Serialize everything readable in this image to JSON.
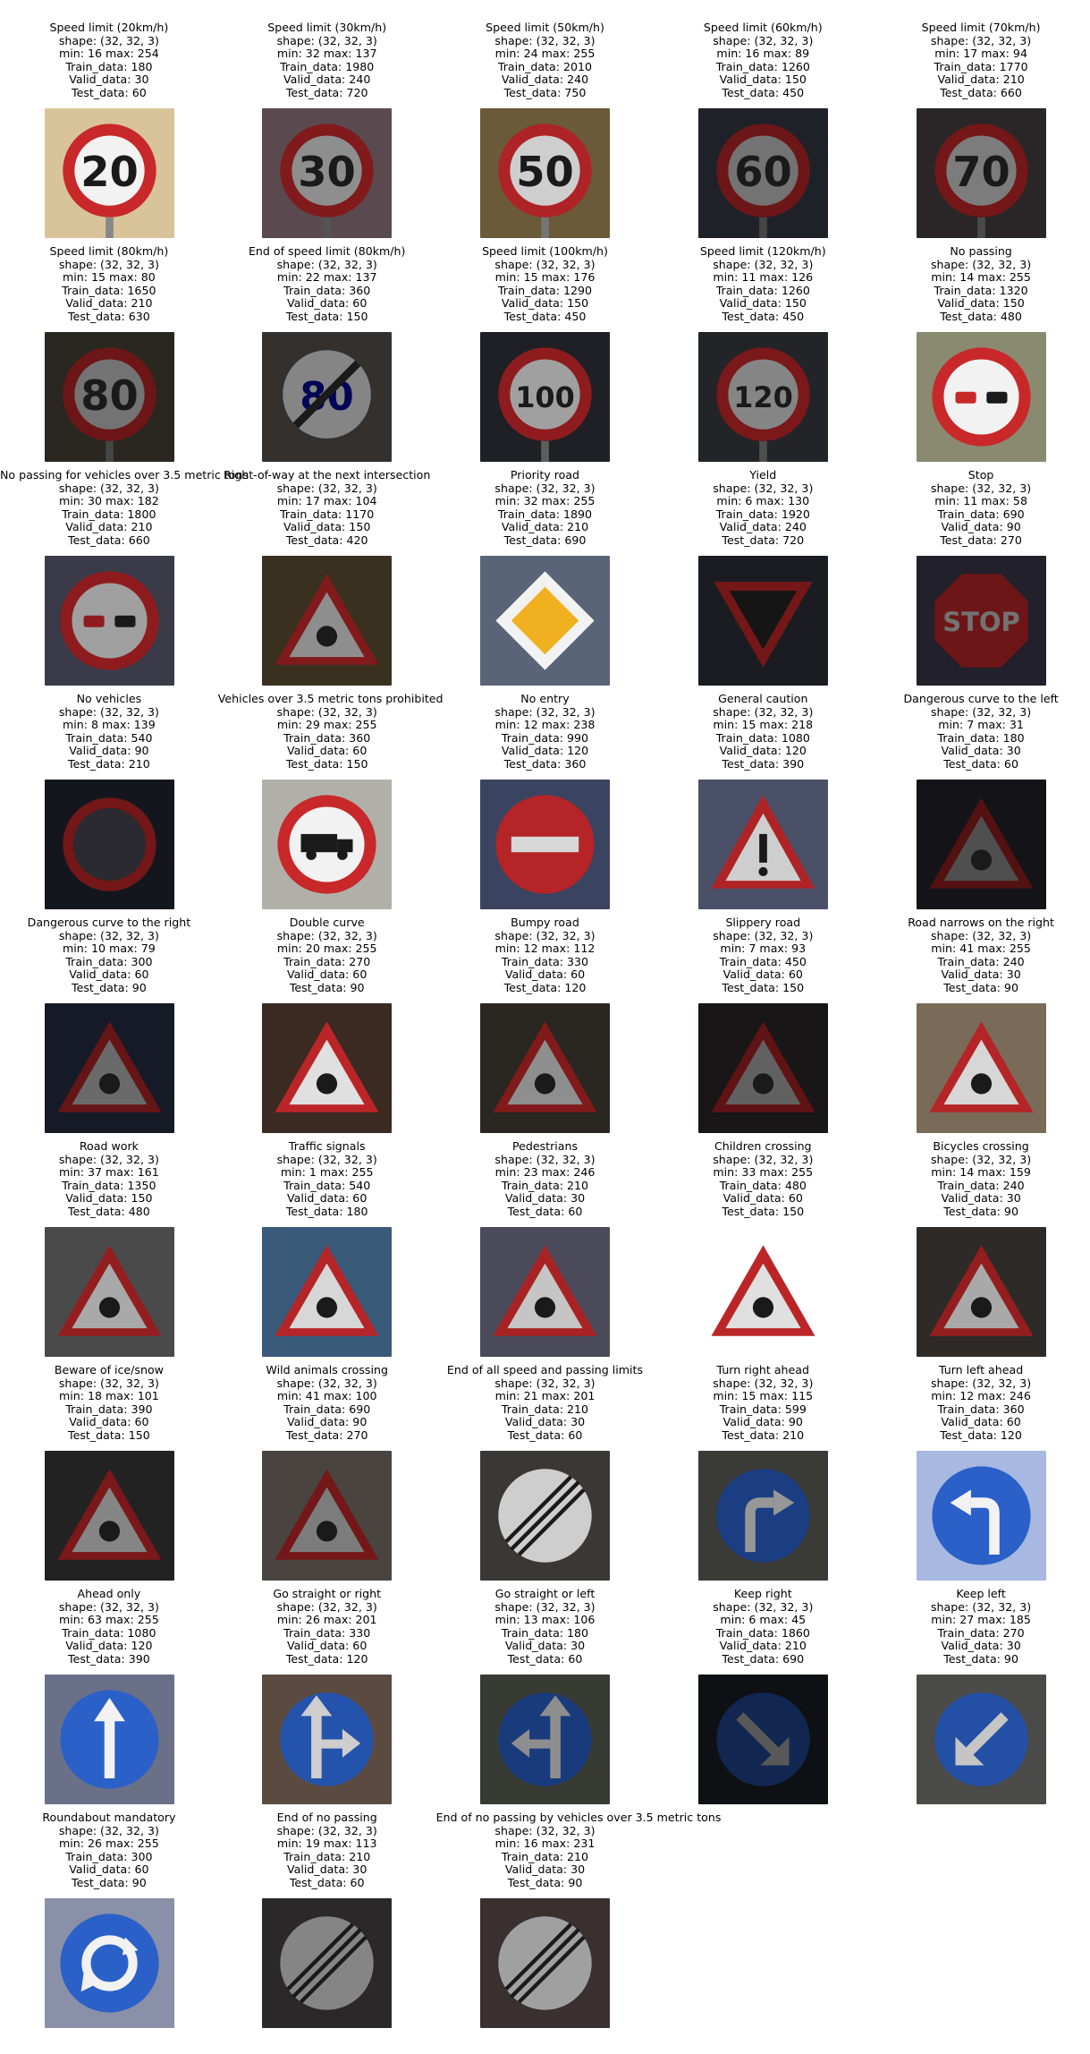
{
  "samples": [
    {
      "title": "Speed limit (20km/h)",
      "shape": "shape: (32, 32, 3)",
      "minmax": "min: 16 max: 254",
      "train": "Train_data: 180",
      "valid": "Valid_data: 30",
      "test": "Test_data: 60",
      "sign": "circle-number",
      "text": "20",
      "bg": "#d9c49a",
      "bright": 1.0
    },
    {
      "title": "Speed limit (30km/h)",
      "shape": "shape: (32, 32, 3)",
      "minmax": "min: 32 max: 137",
      "train": "Train_data: 1980",
      "valid": "Valid_data: 240",
      "test": "Test_data: 720",
      "sign": "circle-number",
      "text": "30",
      "bg": "#5a4a50",
      "bright": 0.45
    },
    {
      "title": "Speed limit (50km/h)",
      "shape": "shape: (32, 32, 3)",
      "minmax": "min: 24 max: 255",
      "train": "Train_data: 2010",
      "valid": "Valid_data: 240",
      "test": "Test_data: 750",
      "sign": "circle-number",
      "text": "50",
      "bg": "#6a5a3a",
      "bright": 0.8
    },
    {
      "title": "Speed limit (60km/h)",
      "shape": "shape: (32, 32, 3)",
      "minmax": "min: 16 max: 89",
      "train": "Train_data: 1260",
      "valid": "Valid_data: 150",
      "test": "Test_data: 450",
      "sign": "circle-number",
      "text": "60",
      "bg": "#1e2228",
      "bright": 0.3
    },
    {
      "title": "Speed limit (70km/h)",
      "shape": "shape: (32, 32, 3)",
      "minmax": "min: 17 max: 94",
      "train": "Train_data: 1770",
      "valid": "Valid_data: 210",
      "test": "Test_data: 660",
      "sign": "circle-number",
      "text": "70",
      "bg": "#2a2628",
      "bright": 0.35
    },
    {
      "title": "Speed limit (80km/h)",
      "shape": "shape: (32, 32, 3)",
      "minmax": "min: 15 max: 80",
      "train": "Train_data: 1650",
      "valid": "Valid_data: 210",
      "test": "Test_data: 630",
      "sign": "circle-number",
      "text": "80",
      "bg": "#2a2620",
      "bright": 0.3
    },
    {
      "title": "End of speed limit (80km/h)",
      "shape": "shape: (32, 32, 3)",
      "minmax": "min: 22 max: 137",
      "train": "Train_data: 360",
      "valid": "Valid_data: 60",
      "test": "Test_data: 150",
      "sign": "end-number",
      "text": "80",
      "bg": "#33302e",
      "bright": 0.4
    },
    {
      "title": "Speed limit (100km/h)",
      "shape": "shape: (32, 32, 3)",
      "minmax": "min: 15 max: 176",
      "train": "Train_data: 1290",
      "valid": "Valid_data: 150",
      "test": "Test_data: 450",
      "sign": "circle-number",
      "text": "100",
      "bg": "#1e2026",
      "bright": 0.55
    },
    {
      "title": "Speed limit (120km/h)",
      "shape": "shape: (32, 32, 3)",
      "minmax": "min: 11 max: 126",
      "train": "Train_data: 1260",
      "valid": "Valid_data: 150",
      "test": "Test_data: 450",
      "sign": "circle-number",
      "text": "120",
      "bg": "#222428",
      "bright": 0.4
    },
    {
      "title": "No passing",
      "shape": "shape: (32, 32, 3)",
      "minmax": "min: 14 max: 255",
      "train": "Train_data: 1320",
      "valid": "Valid_data: 150",
      "test": "Test_data: 480",
      "sign": "circle-cars",
      "text": "",
      "bg": "#8a8a70",
      "bright": 1.0
    },
    {
      "title": "No passing for vehicles over 3.5 metric tons",
      "shape": "shape: (32, 32, 3)",
      "minmax": "min: 30 max: 182",
      "train": "Train_data: 1800",
      "valid": "Valid_data: 210",
      "test": "Test_data: 660",
      "sign": "circle-cars",
      "text": "",
      "bg": "#3a3a48",
      "bright": 0.55
    },
    {
      "title": "Right-of-way at the next intersection",
      "shape": "shape: (32, 32, 3)",
      "minmax": "min: 17 max: 104",
      "train": "Train_data: 1170",
      "valid": "Valid_data: 150",
      "test": "Test_data: 420",
      "sign": "triangle",
      "text": "",
      "bg": "#3a3020",
      "bright": 0.45
    },
    {
      "title": "Priority road",
      "shape": "shape: (32, 32, 3)",
      "minmax": "min: 32 max: 255",
      "train": "Train_data: 1890",
      "valid": "Valid_data: 210",
      "test": "Test_data: 690",
      "sign": "diamond",
      "text": "",
      "bg": "#5a6478",
      "bright": 1.0
    },
    {
      "title": "Yield",
      "shape": "shape: (32, 32, 3)",
      "minmax": "min: 6 max: 130",
      "train": "Train_data: 1920",
      "valid": "Valid_data: 240",
      "test": "Test_data: 720",
      "sign": "yield",
      "text": "",
      "bg": "#1a1c22",
      "bright": 0.35
    },
    {
      "title": "Stop",
      "shape": "shape: (32, 32, 3)",
      "minmax": "min: 11 max: 58",
      "train": "Train_data: 690",
      "valid": "Valid_data: 90",
      "test": "Test_data: 270",
      "sign": "stop",
      "text": "STOP",
      "bg": "#22202a",
      "bright": 0.3
    },
    {
      "title": "No vehicles",
      "shape": "shape: (32, 32, 3)",
      "minmax": "min: 8 max: 139",
      "train": "Train_data: 540",
      "valid": "Valid_data: 90",
      "test": "Test_data: 210",
      "sign": "circle-empty",
      "text": "",
      "bg": "#14161e",
      "bright": 0.35
    },
    {
      "title": "Vehicles over 3.5 metric tons prohibited",
      "shape": "shape: (32, 32, 3)",
      "minmax": "min: 29 max: 255",
      "train": "Train_data: 360",
      "valid": "Valid_data: 60",
      "test": "Test_data: 150",
      "sign": "circle-truck",
      "text": "",
      "bg": "#b0b0a8",
      "bright": 1.0
    },
    {
      "title": "No entry",
      "shape": "shape: (32, 32, 3)",
      "minmax": "min: 12 max: 238",
      "train": "Train_data: 990",
      "valid": "Valid_data: 120",
      "test": "Test_data: 360",
      "sign": "no-entry",
      "text": "",
      "bg": "#3a4460",
      "bright": 0.85
    },
    {
      "title": "General caution",
      "shape": "shape: (32, 32, 3)",
      "minmax": "min: 15 max: 218",
      "train": "Train_data: 1080",
      "valid": "Valid_data: 120",
      "test": "Test_data: 390",
      "sign": "caution",
      "text": "",
      "bg": "#4a5068",
      "bright": 0.8
    },
    {
      "title": "Dangerous curve to the left",
      "shape": "shape: (32, 32, 3)",
      "minmax": "min: 7 max: 31",
      "train": "Train_data: 180",
      "valid": "Valid_data: 30",
      "test": "Test_data: 60",
      "sign": "triangle",
      "text": "",
      "bg": "#141418",
      "bright": 0.1
    },
    {
      "title": "Dangerous curve to the right",
      "shape": "shape: (32, 32, 3)",
      "minmax": "min: 10 max: 79",
      "train": "Train_data: 300",
      "valid": "Valid_data: 60",
      "test": "Test_data: 90",
      "sign": "triangle",
      "text": "",
      "bg": "#161a26",
      "bright": 0.25
    },
    {
      "title": "Double curve",
      "shape": "shape: (32, 32, 3)",
      "minmax": "min: 20 max: 255",
      "train": "Train_data: 270",
      "valid": "Valid_data: 60",
      "test": "Test_data: 90",
      "sign": "triangle",
      "text": "",
      "bg": "#3a2a22",
      "bright": 0.9
    },
    {
      "title": "Bumpy road",
      "shape": "shape: (32, 32, 3)",
      "minmax": "min: 12 max: 112",
      "train": "Train_data: 330",
      "valid": "Valid_data: 60",
      "test": "Test_data: 120",
      "sign": "triangle",
      "text": "",
      "bg": "#2a2622",
      "bright": 0.45
    },
    {
      "title": "Slippery road",
      "shape": "shape: (32, 32, 3)",
      "minmax": "min: 7 max: 93",
      "train": "Train_data: 450",
      "valid": "Valid_data: 60",
      "test": "Test_data: 150",
      "sign": "triangle",
      "text": "",
      "bg": "#181616",
      "bright": 0.2
    },
    {
      "title": "Road narrows on the right",
      "shape": "shape: (32, 32, 3)",
      "minmax": "min: 41 max: 255",
      "train": "Train_data: 240",
      "valid": "Valid_data: 30",
      "test": "Test_data: 90",
      "sign": "triangle",
      "text": "",
      "bg": "#7a6a58",
      "bright": 0.85
    },
    {
      "title": "Road work",
      "shape": "shape: (32, 32, 3)",
      "minmax": "min: 37 max: 161",
      "train": "Train_data: 1350",
      "valid": "Valid_data: 150",
      "test": "Test_data: 480",
      "sign": "triangle",
      "text": "",
      "bg": "#4a4a4a",
      "bright": 0.6
    },
    {
      "title": "Traffic signals",
      "shape": "shape: (32, 32, 3)",
      "minmax": "min: 1 max: 255",
      "train": "Train_data: 540",
      "valid": "Valid_data: 60",
      "test": "Test_data: 180",
      "sign": "triangle",
      "text": "",
      "bg": "#3a5a7a",
      "bright": 0.85
    },
    {
      "title": "Pedestrians",
      "shape": "shape: (32, 32, 3)",
      "minmax": "min: 23 max: 246",
      "train": "Train_data: 210",
      "valid": "Valid_data: 30",
      "test": "Test_data: 60",
      "sign": "triangle",
      "text": "",
      "bg": "#4a4a5a",
      "bright": 0.75
    },
    {
      "title": "Children crossing",
      "shape": "shape: (32, 32, 3)",
      "minmax": "min: 33 max: 255",
      "train": "Train_data: 480",
      "valid": "Valid_data: 60",
      "test": "Test_data: 150",
      "sign": "triangle",
      "text": "",
      "bg": "#ffffff",
      "bright": 0.9
    },
    {
      "title": "Bicycles crossing",
      "shape": "shape: (32, 32, 3)",
      "minmax": "min: 14 max: 159",
      "train": "Train_data: 240",
      "valid": "Valid_data: 30",
      "test": "Test_data: 90",
      "sign": "triangle",
      "text": "",
      "bg": "#2e2a28",
      "bright": 0.6
    },
    {
      "title": "Beware of ice/snow",
      "shape": "shape: (32, 32, 3)",
      "minmax": "min: 18 max: 101",
      "train": "Train_data: 390",
      "valid": "Valid_data: 60",
      "test": "Test_data: 150",
      "sign": "triangle",
      "text": "",
      "bg": "#222222",
      "bright": 0.4
    },
    {
      "title": "Wild animals crossing",
      "shape": "shape: (32, 32, 3)",
      "minmax": "min: 41 max: 100",
      "train": "Train_data: 690",
      "valid": "Valid_data: 90",
      "test": "Test_data: 270",
      "sign": "triangle",
      "text": "",
      "bg": "#4a4440",
      "bright": 0.35
    },
    {
      "title": "End of all speed and passing limits",
      "shape": "shape: (32, 32, 3)",
      "minmax": "min: 21 max: 201",
      "train": "Train_data: 210",
      "valid": "Valid_data: 30",
      "test": "Test_data: 60",
      "sign": "end-all",
      "text": "",
      "bg": "#3a3836",
      "bright": 0.8
    },
    {
      "title": "Turn right ahead",
      "shape": "shape: (32, 32, 3)",
      "minmax": "min: 15 max: 115",
      "train": "Train_data: 599",
      "valid": "Valid_data: 90",
      "test": "Test_data: 210",
      "sign": "blue-right",
      "text": "",
      "bg": "#3a3a36",
      "bright": 0.5
    },
    {
      "title": "Turn left ahead",
      "shape": "shape: (32, 32, 3)",
      "minmax": "min: 12 max: 246",
      "train": "Train_data: 360",
      "valid": "Valid_data: 60",
      "test": "Test_data: 120",
      "sign": "blue-left",
      "text": "",
      "bg": "#a8b8e0",
      "bright": 1.0
    },
    {
      "title": "Ahead only",
      "shape": "shape: (32, 32, 3)",
      "minmax": "min: 63 max: 255",
      "train": "Train_data: 1080",
      "valid": "Valid_data: 120",
      "test": "Test_data: 390",
      "sign": "blue-up",
      "text": "",
      "bg": "#6a7088",
      "bright": 1.0
    },
    {
      "title": "Go straight or right",
      "shape": "shape: (32, 32, 3)",
      "minmax": "min: 26 max: 201",
      "train": "Train_data: 330",
      "valid": "Valid_data: 60",
      "test": "Test_data: 120",
      "sign": "blue-straight-right",
      "text": "",
      "bg": "#5a4a40",
      "bright": 0.8
    },
    {
      "title": "Go straight or left",
      "shape": "shape: (32, 32, 3)",
      "minmax": "min: 13 max: 106",
      "train": "Train_data: 180",
      "valid": "Valid_data: 30",
      "test": "Test_data: 60",
      "sign": "blue-straight-left",
      "text": "",
      "bg": "#383a34",
      "bright": 0.45
    },
    {
      "title": "Keep right",
      "shape": "shape: (32, 32, 3)",
      "minmax": "min: 6 max: 45",
      "train": "Train_data: 1860",
      "valid": "Valid_data: 210",
      "test": "Test_data: 690",
      "sign": "blue-keep-right",
      "text": "",
      "bg": "#0e1014",
      "bright": 0.15
    },
    {
      "title": "Keep left",
      "shape": "shape: (32, 32, 3)",
      "minmax": "min: 27 max: 185",
      "train": "Train_data: 270",
      "valid": "Valid_data: 30",
      "test": "Test_data: 90",
      "sign": "blue-keep-left",
      "text": "",
      "bg": "#4a4a48",
      "bright": 0.75
    },
    {
      "title": "Roundabout mandatory",
      "shape": "shape: (32, 32, 3)",
      "minmax": "min: 26 max: 255",
      "train": "Train_data: 300",
      "valid": "Valid_data: 60",
      "test": "Test_data: 90",
      "sign": "roundabout",
      "text": "",
      "bg": "#8a90a8",
      "bright": 1.0
    },
    {
      "title": "End of no passing",
      "shape": "shape: (32, 32, 3)",
      "minmax": "min: 19 max: 113",
      "train": "Train_data: 210",
      "valid": "Valid_data: 30",
      "test": "Test_data: 60",
      "sign": "end-all",
      "text": "",
      "bg": "#2a2828",
      "bright": 0.4
    },
    {
      "title": "End of no passing by vehicles over 3.5 metric tons",
      "shape": "shape: (32, 32, 3)",
      "minmax": "min: 16 max: 231",
      "train": "Train_data: 210",
      "valid": "Valid_data: 30",
      "test": "Test_data: 90",
      "sign": "end-all",
      "text": "",
      "bg": "#3a3030",
      "bright": 0.55
    }
  ]
}
